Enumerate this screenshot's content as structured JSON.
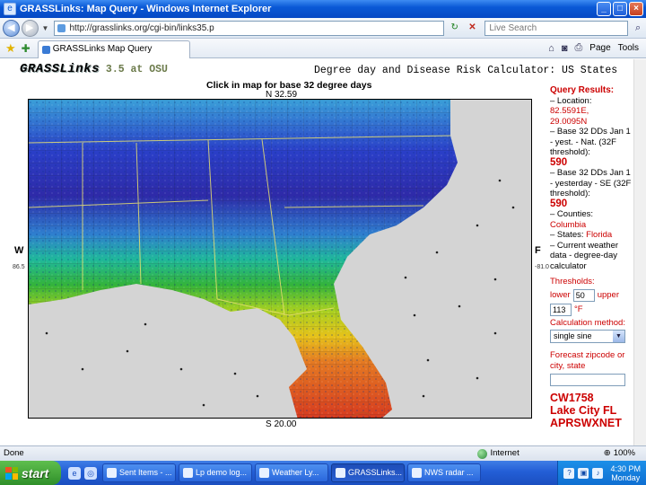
{
  "window": {
    "title": "GRASSLinks: Map Query - Windows Internet Explorer",
    "minimize": "_",
    "maximize": "□",
    "close": "×"
  },
  "address": {
    "url": "http://grasslinks.org/cgi-bin/links35.p",
    "search_placeholder": "Live Search"
  },
  "tabs": [
    {
      "label": "GRASSLinks Map Query"
    }
  ],
  "toolbar": {
    "page_label": "Page",
    "tools_label": "Tools"
  },
  "page": {
    "logo": "GRASSLinks",
    "logo_suffix": "3.5 at OSU",
    "title": "Degree day and Disease Risk Calculator: US States",
    "instruction": "Click in map for base 32 degree days",
    "north": "N 32.59",
    "south": "S 20.00",
    "west": "W",
    "west_value": "86.5",
    "east": "F",
    "east_value": "-81.0"
  },
  "results": {
    "header": "Query Results:",
    "location_label": "– Location:",
    "location_lat": "82.5591E,",
    "location_lon": "29.0095N",
    "base32_label": "– Base 32 DDs Jan 1 - yest. - Nat. (32F threshold):",
    "base32_value": "590",
    "se_label": "– Base 32 DDs Jan 1 - yesterday - SE (32F threshold):",
    "se_value": "590",
    "counties_label": "– Counties:",
    "county": "Columbia",
    "states_label": "– States:",
    "state": "Florida",
    "current_weather": "– Current weather data - degree-day calculator",
    "thresholds_label": "Thresholds:",
    "lower_label": "lower",
    "lower_value": "50",
    "upper_label": "upper",
    "upper_value": "113",
    "unit": "°F",
    "calc_method_label": "Calculation method:",
    "calc_method_value": "single sine",
    "forecast_label": "Forecast zipcode or city, state",
    "station_id": "CW1758",
    "station_city": "Lake City FL",
    "station_net": "APRSWXNET"
  },
  "status": {
    "text": "Done",
    "zone": "Internet",
    "zoom": "100%"
  },
  "taskbar": {
    "start": "start",
    "tasks": [
      {
        "label": "Sent Items - ..."
      },
      {
        "label": "Lp demo log..."
      },
      {
        "label": "Weather Ly..."
      },
      {
        "label": "GRASSLinks..."
      },
      {
        "label": "NWS radar ..."
      }
    ],
    "time": "4:30 PM",
    "day": "Monday"
  }
}
